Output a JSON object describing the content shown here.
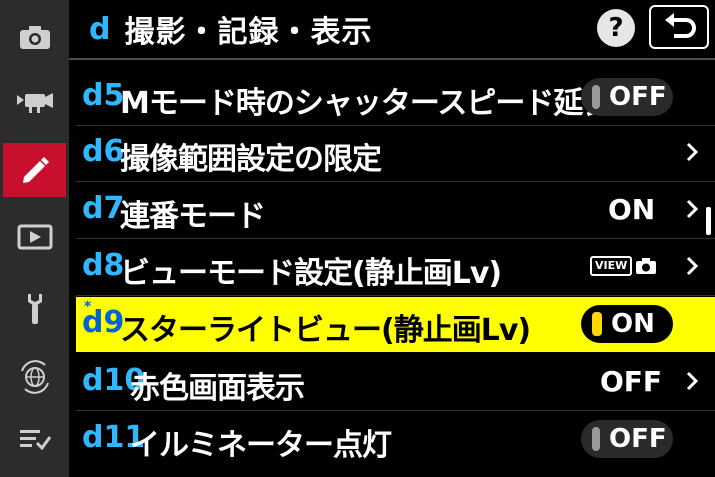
{
  "header": {
    "letter": "d",
    "title": "撮影・記録・表示",
    "help": "?"
  },
  "sidebar": {
    "items": [
      {
        "name": "photo-shooting",
        "icon": "camera-icon"
      },
      {
        "name": "movie-recording",
        "icon": "movie-camera-icon"
      },
      {
        "name": "custom-settings",
        "icon": "pencil-icon",
        "active": true
      },
      {
        "name": "playback",
        "icon": "playback-icon"
      },
      {
        "name": "setup",
        "icon": "wrench-icon"
      },
      {
        "name": "network",
        "icon": "network-icon"
      },
      {
        "name": "my-menu",
        "icon": "my-menu-icon"
      }
    ]
  },
  "rows": [
    {
      "code": "d5",
      "label": "Mモード時のシャッタースピード延長",
      "control": "toggle",
      "value": "OFF"
    },
    {
      "code": "d6",
      "label": "撮像範囲設定の限定",
      "control": "chevron",
      "value": ""
    },
    {
      "code": "d7",
      "label": "連番モード",
      "control": "chevron",
      "value": "ON"
    },
    {
      "code": "d8",
      "label": "ビューモード設定(静止画Lv)",
      "control": "view-chevron",
      "value": "VIEW"
    },
    {
      "code": "d9",
      "label": "スターライトビュー(静止画Lv)",
      "control": "toggle",
      "value": "ON",
      "selected": true,
      "mark": "*"
    },
    {
      "code": "d10",
      "label": "赤色画面表示",
      "control": "chevron",
      "value": "OFF"
    },
    {
      "code": "d11",
      "label": "イルミネーター点灯",
      "control": "toggle",
      "value": "OFF"
    }
  ],
  "colors": {
    "accent": "#2fb7ff",
    "active_tab": "#c8102e",
    "highlight": "#ffff00"
  }
}
